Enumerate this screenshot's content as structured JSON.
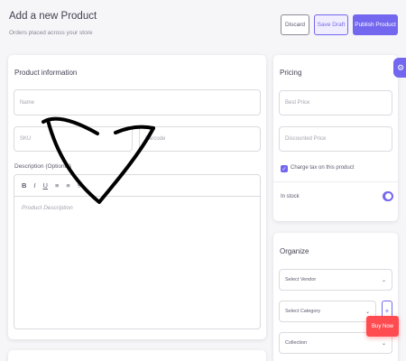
{
  "header": {
    "title": "Add a new Product",
    "subtitle": "Orders placed across your store"
  },
  "actions": {
    "discard": "Discard",
    "save_draft": "Save Draft",
    "publish": "Publish Product"
  },
  "product_info": {
    "title": "Product information",
    "name_placeholder": "Name",
    "sku_placeholder": "SKU",
    "barcode_placeholder": "Barcode",
    "description_label": "Description (Optional)",
    "toolbar": [
      "B",
      "I",
      "U",
      "≡",
      "≡",
      "%"
    ],
    "description_placeholder": "Product Description"
  },
  "pricing": {
    "title": "Pricing",
    "base_price_placeholder": "Best Price",
    "discounted_price_placeholder": "Discounted Price",
    "charge_tax_label": "Charge tax on this product",
    "charge_tax_checked": true,
    "in_stock_label": "In stock",
    "in_stock_on": true
  },
  "organize": {
    "title": "Organize",
    "vendor": "Select Vendor",
    "category": "Select Category",
    "collection": "Collection"
  },
  "floating": {
    "buy_now": "Buy Now",
    "settings_icon": "gear-icon"
  },
  "colors": {
    "primary": "#7367f0",
    "danger": "#ff4c51",
    "scribble": "#000000"
  }
}
